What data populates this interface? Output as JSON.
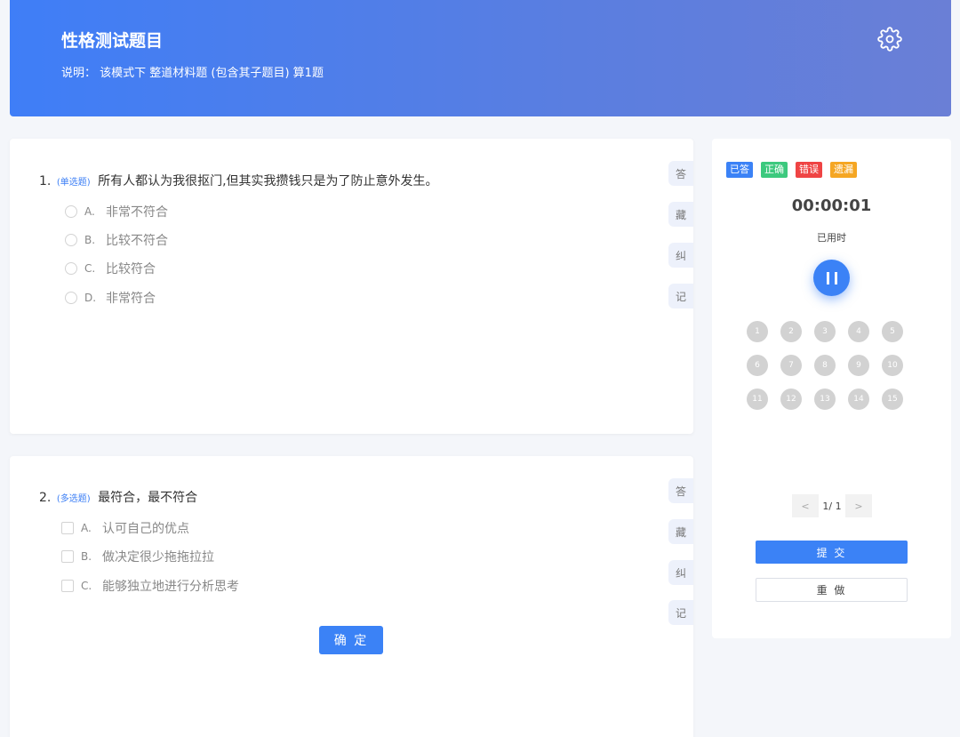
{
  "header": {
    "title": "性格测试题目",
    "description": "说明：  该模式下 整道材料题 (包含其子题目) 算1题"
  },
  "questions": [
    {
      "number": "1.",
      "type_tag": "(单选题)",
      "text": "所有人都认为我很抠门,但其实我攒钱只是为了防止意外发生。",
      "options": [
        {
          "letter": "A.",
          "label": "非常不符合"
        },
        {
          "letter": "B.",
          "label": "比较不符合"
        },
        {
          "letter": "C.",
          "label": "比较符合"
        },
        {
          "letter": "D.",
          "label": "非常符合"
        }
      ]
    },
    {
      "number": "2.",
      "type_tag": "(多选题)",
      "text": "最符合，最不符合",
      "options": [
        {
          "letter": "A.",
          "label": "认可自己的优点"
        },
        {
          "letter": "B.",
          "label": "做决定很少拖拖拉拉"
        },
        {
          "letter": "C.",
          "label": "能够独立地进行分析思考"
        }
      ],
      "confirm_label": "确 定"
    }
  ],
  "side_actions": [
    "答",
    "藏",
    "纠",
    "记"
  ],
  "panel": {
    "legend": [
      {
        "label": "已答",
        "color": "#3b82f6"
      },
      {
        "label": "正确",
        "color": "#3cc97e"
      },
      {
        "label": "错误",
        "color": "#ef4444"
      },
      {
        "label": "遗漏",
        "color": "#f5a623"
      }
    ],
    "timer": "00:00:01",
    "timer_label": "已用时",
    "question_numbers": [
      "1",
      "2",
      "3",
      "4",
      "5",
      "6",
      "7",
      "8",
      "9",
      "10",
      "11",
      "12",
      "13",
      "14",
      "15"
    ],
    "pager": {
      "prev": "<",
      "info": "1/ 1",
      "next": ">"
    },
    "submit_label": "提 交",
    "redo_label": "重 做"
  }
}
